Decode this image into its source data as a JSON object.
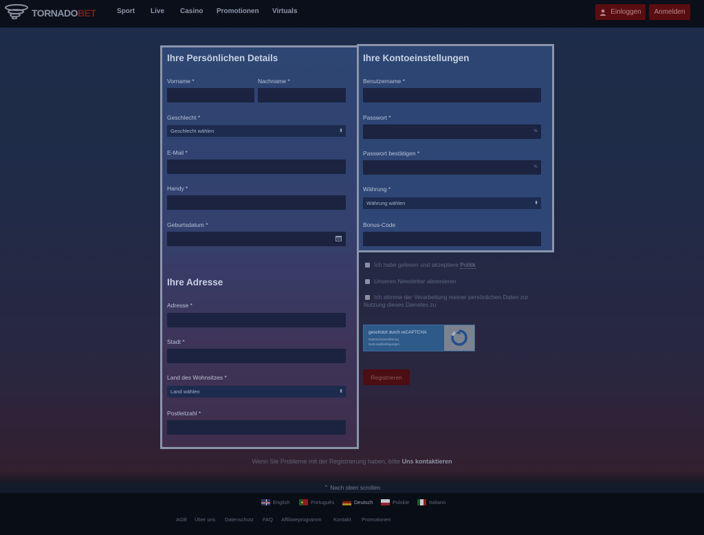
{
  "header": {
    "logo_main": "TORNADO",
    "logo_accent": "BET",
    "nav": [
      "Sport",
      "Live",
      "Casino",
      "Promotionen",
      "Virtuals"
    ],
    "login_label": "Einloggen",
    "register_label": "Anmelden"
  },
  "personal": {
    "title": "Ihre Persönlichen Details",
    "firstname_label": "Vorname *",
    "lastname_label": "Nachname *",
    "gender_label": "Geschlecht *",
    "gender_value": "Geschlecht wählen",
    "email_label": "E-Mail *",
    "phone_label": "Handy *",
    "birthdate_label": "Geburtsdatum *"
  },
  "address": {
    "title": "Ihre Adresse",
    "street_label": "Adresse *",
    "city_label": "Stadt *",
    "country_label": "Land des Wohnsitzes *",
    "country_value": "Land wählen",
    "zip_label": "Postleitzahl *"
  },
  "account": {
    "title": "Ihre Kontoeinstellungen",
    "username_label": "Benutzername *",
    "password_label": "Passwort *",
    "password_confirm_label": "Passwort bestätigen *",
    "currency_label": "Währung *",
    "currency_value": "Währung wählen",
    "bonus_label": "Bonus-Code",
    "eye_glyph": "%"
  },
  "consents": {
    "terms_prefix": "Ich habe gelesen und akzeptiere ",
    "terms_link": "Politik",
    "newsletter": "Unseren Newsletter abonnieren",
    "privacy": "Ich stimme der Verarbeitung meiner persönlichen Daten zur Nutzung dieses Dienstes zu"
  },
  "captcha": {
    "title": "geschützt durch reCAPTCHA",
    "line1": "Datenschutzerklärung",
    "line2": "Nutzungsbedingungen"
  },
  "submit_label": "Registrieren",
  "help": {
    "prefix": "Wenn Sie Probleme mit der Registrierung haben, bitte ",
    "link": "Uns kontaktieren"
  },
  "footer": {
    "scroll_up": "⌃ Nach oben scrollen",
    "languages": [
      "English",
      "Português",
      "Deutsch",
      "Polskie",
      "Italiano"
    ],
    "active_language": "Deutsch",
    "links": [
      "AGB",
      "Über uns",
      "Datenschutz",
      "FAQ",
      "Affiliateprogramm",
      "Kontakt",
      "Promotionen"
    ]
  },
  "colors": {
    "panel_border": "#8c95ac",
    "brand_red": "#5a0d10",
    "input_bg": "#1b2340"
  }
}
